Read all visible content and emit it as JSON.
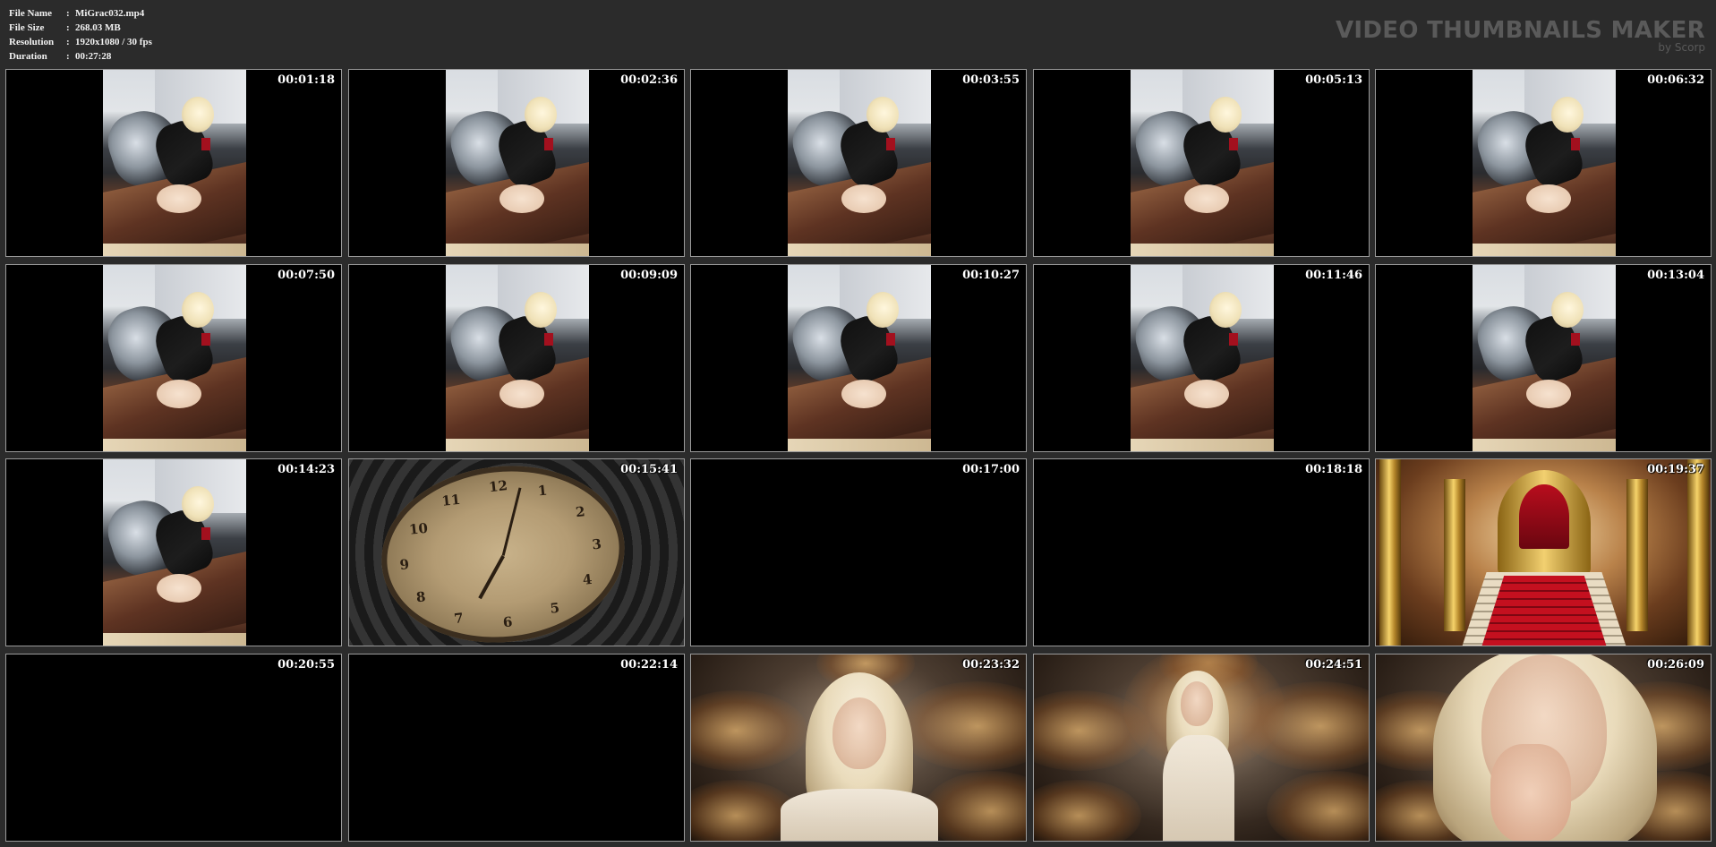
{
  "file_info": {
    "rows": [
      {
        "label": "File Name",
        "value": "MiGrac032.mp4"
      },
      {
        "label": "File Size",
        "value": "268.03 MB"
      },
      {
        "label": "Resolution",
        "value": "1920x1080 / 30 fps"
      },
      {
        "label": "Duration",
        "value": "00:27:28"
      }
    ],
    "separator": ":"
  },
  "brand": {
    "title": "VIDEO THUMBNAILS MAKER",
    "subtitle": "by Scorp"
  },
  "thumbnails": [
    {
      "timestamp": "00:01:18",
      "scene": "portrait-couch"
    },
    {
      "timestamp": "00:02:36",
      "scene": "portrait-couch"
    },
    {
      "timestamp": "00:03:55",
      "scene": "portrait-couch"
    },
    {
      "timestamp": "00:05:13",
      "scene": "portrait-couch"
    },
    {
      "timestamp": "00:06:32",
      "scene": "portrait-couch"
    },
    {
      "timestamp": "00:07:50",
      "scene": "portrait-couch"
    },
    {
      "timestamp": "00:09:09",
      "scene": "portrait-couch"
    },
    {
      "timestamp": "00:10:27",
      "scene": "portrait-couch"
    },
    {
      "timestamp": "00:11:46",
      "scene": "portrait-couch"
    },
    {
      "timestamp": "00:13:04",
      "scene": "portrait-couch"
    },
    {
      "timestamp": "00:14:23",
      "scene": "portrait-couch"
    },
    {
      "timestamp": "00:15:41",
      "scene": "clock"
    },
    {
      "timestamp": "00:17:00",
      "scene": "black"
    },
    {
      "timestamp": "00:18:18",
      "scene": "black"
    },
    {
      "timestamp": "00:19:37",
      "scene": "throne"
    },
    {
      "timestamp": "00:20:55",
      "scene": "black"
    },
    {
      "timestamp": "00:22:14",
      "scene": "black"
    },
    {
      "timestamp": "00:23:32",
      "scene": "woman-center"
    },
    {
      "timestamp": "00:24:51",
      "scene": "woman-standing"
    },
    {
      "timestamp": "00:26:09",
      "scene": "woman-closeup"
    }
  ],
  "clock_numbers": [
    "12",
    "1",
    "2",
    "3",
    "4",
    "5",
    "6",
    "7",
    "8",
    "9",
    "10",
    "11"
  ],
  "colors": {
    "background": "#2b2b2b",
    "cell_border": "#9a9a9a",
    "brand_text": "#5a5a5a",
    "timestamp_text": "#ffffff"
  }
}
